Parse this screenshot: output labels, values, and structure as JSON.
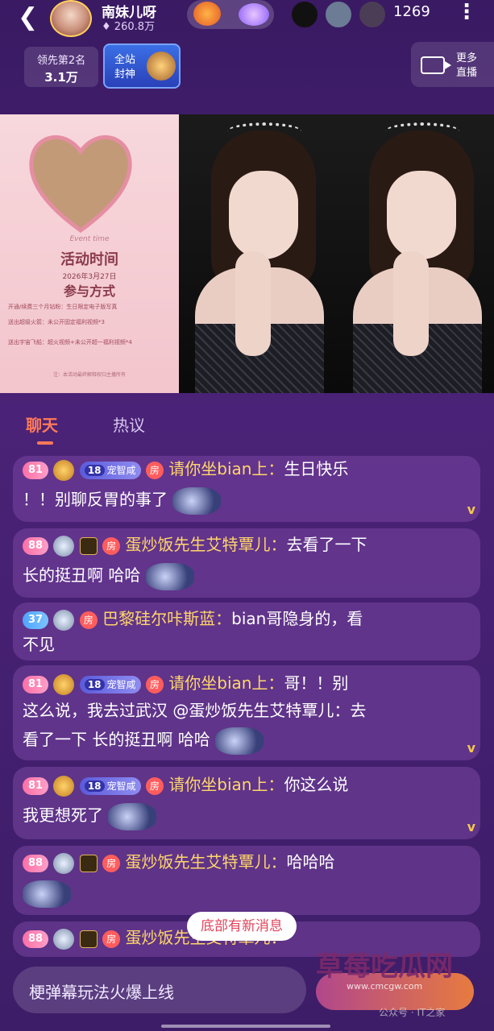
{
  "host": {
    "name": "南妹儿呀",
    "fans": "260.8万"
  },
  "viewer_count": "1269",
  "rank": {
    "label": "领先第2名",
    "value": "3.1万"
  },
  "god": {
    "label1": "全站",
    "label2": "封神"
  },
  "more_live": {
    "line1": "更多",
    "line2": "直播"
  },
  "poster": {
    "en": "Event time",
    "title": "活动时间",
    "date": "2026年3月27日",
    "how": "参与方式",
    "line1": "开通/续费三个月钻粉：生日限定电子版写真",
    "line2": "送出超级火箭：未公开固定福利视频*3",
    "line3": "送出宇宙飞船：超火视频+未公开超一福利视频*4",
    "foot": "注：本活动最终解释权归主播所有"
  },
  "tabs": {
    "chat": "聊天",
    "hot": "热议"
  },
  "fan_label": "宠智咸",
  "room_label": "房",
  "messages": [
    {
      "lvl": "81",
      "fan": "18",
      "name": "请你坐bian上：",
      "text_a": "生日快乐",
      "text_b": "！！别聊反胃的事了"
    },
    {
      "lvl": "88",
      "name": "蛋炒饭先生艾特覃儿：",
      "text_a": "去看了一下",
      "text_b": "长的挺丑啊 哈哈"
    },
    {
      "lvl": "37",
      "name": "巴黎硅尔咔斯蓝：",
      "text_a": "bian哥隐身的，看",
      "text_b": "不见"
    },
    {
      "lvl": "81",
      "fan": "18",
      "name": "请你坐bian上：",
      "text_a": "哥！！别",
      "text_b": "这么说，我去过武汉 @蛋炒饭先生艾特覃儿：去",
      "text_c": "看了一下 长的挺丑啊 哈哈"
    },
    {
      "lvl": "81",
      "fan": "18",
      "name": "请你坐bian上：",
      "text_a": "你这么说",
      "text_b": "我更想死了"
    },
    {
      "lvl": "88",
      "name": "蛋炒饭先生艾特覃儿：",
      "text_a": "哈哈哈"
    },
    {
      "lvl": "88",
      "name": "蛋炒饭先生艾特覃儿：",
      "text_a": ""
    }
  ],
  "new_messages_label": "底部有新消息",
  "input_placeholder": "梗弹幕玩法火爆上线",
  "watermark": {
    "site": "草莓吃瓜网",
    "url": "www.cmcgw.com",
    "source": "公众号 · IT之家"
  }
}
